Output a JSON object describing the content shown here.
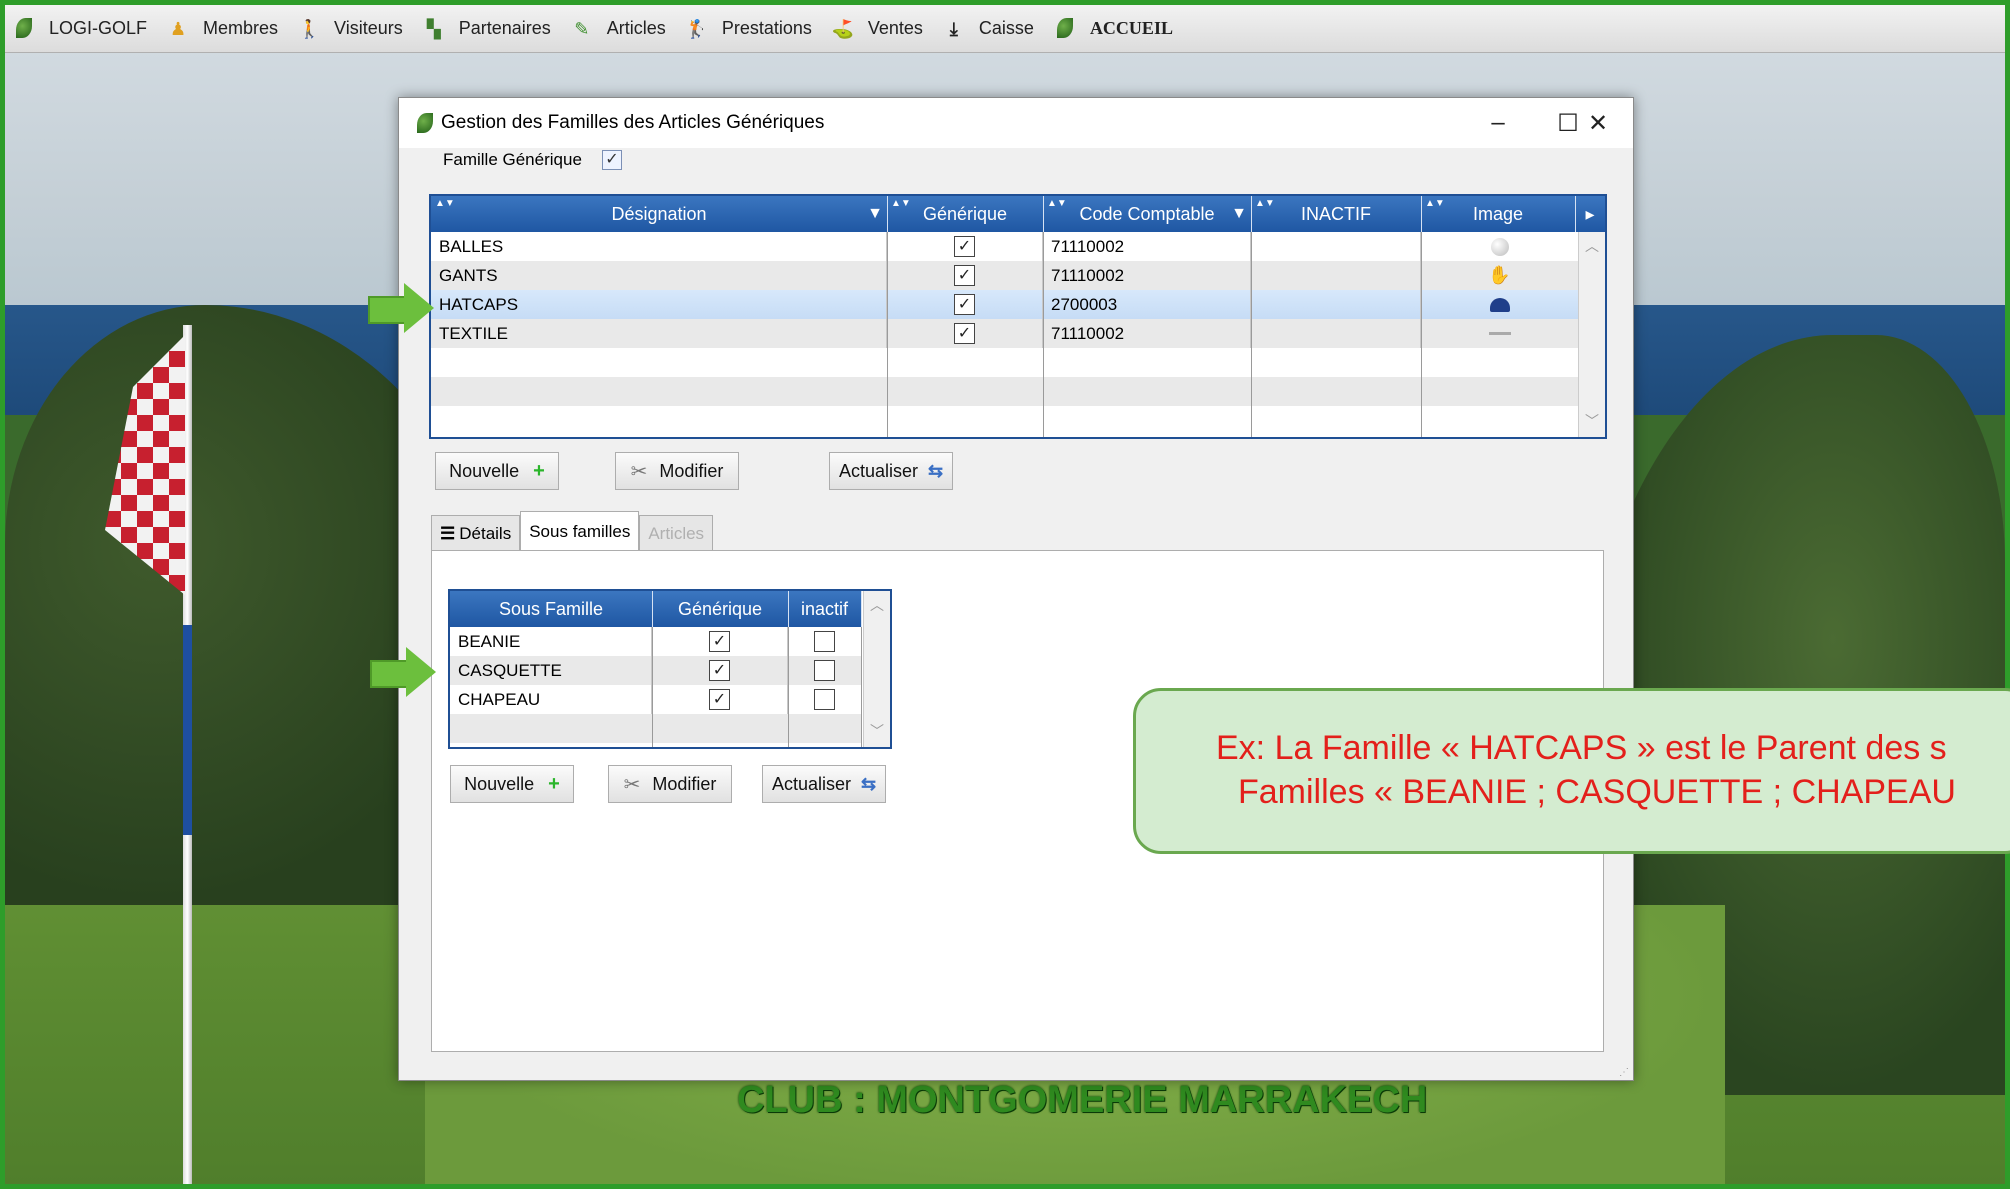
{
  "menubar": {
    "items": [
      {
        "label": "LOGI-GOLF",
        "icon": "logo-leaf-icon"
      },
      {
        "label": "Membres",
        "icon": "member-icon"
      },
      {
        "label": "Visiteurs",
        "icon": "walking-icon"
      },
      {
        "label": "Partenaires",
        "icon": "partner-icon"
      },
      {
        "label": "Articles",
        "icon": "pencil-icon"
      },
      {
        "label": "Prestations",
        "icon": "golfer-icon"
      },
      {
        "label": "Ventes",
        "icon": "golf-shoe-icon"
      },
      {
        "label": "Caisse",
        "icon": "download-icon"
      },
      {
        "label": "ACCUEIL",
        "icon": "home-leaf-icon"
      }
    ]
  },
  "dialog": {
    "title": "Gestion des Familles des Articles Génériques",
    "famille_generique_label": "Famille Générique",
    "famille_generique_checked": true,
    "families_grid": {
      "columns": [
        "Désignation",
        "Générique",
        "Code Comptable",
        "INACTIF",
        "Image"
      ],
      "rows": [
        {
          "designation": "BALLES",
          "generique": true,
          "code": "71110002",
          "inactif": "",
          "image": "golf-ball-icon"
        },
        {
          "designation": "GANTS",
          "generique": true,
          "code": "71110002",
          "inactif": "",
          "image": "glove-icon"
        },
        {
          "designation": "HATCAPS",
          "generique": true,
          "code": "2700003",
          "inactif": "",
          "image": "cap-icon",
          "selected": true
        },
        {
          "designation": "TEXTILE",
          "generique": true,
          "code": "71110002",
          "inactif": "",
          "image": "textile-icon"
        }
      ]
    },
    "buttons_top": {
      "nouvelle": "Nouvelle",
      "modifier": "Modifier",
      "actualiser": "Actualiser"
    },
    "tabs": [
      {
        "label": "Détails",
        "state": "normal"
      },
      {
        "label": "Sous familles",
        "state": "active"
      },
      {
        "label": "Articles",
        "state": "disabled"
      }
    ],
    "subfamilies_grid": {
      "columns": [
        "Sous Famille",
        "Générique",
        "inactif"
      ],
      "rows": [
        {
          "name": "BEANIE",
          "generique": true,
          "inactif": false
        },
        {
          "name": "CASQUETTE",
          "generique": true,
          "inactif": false
        },
        {
          "name": "CHAPEAU",
          "generique": true,
          "inactif": false
        }
      ]
    },
    "buttons_bottom": {
      "nouvelle": "Nouvelle",
      "modifier": "Modifier",
      "actualiser": "Actualiser"
    }
  },
  "callout": {
    "line1": "Ex: La Famille « HATCAPS » est le Parent des s",
    "line2": "Familles « BEANIE ; CASQUETTE ; CHAPEAU",
    "text_color": "#e3201b"
  },
  "footer": {
    "club": "CLUB : MONTGOMERIE MARRAKECH"
  },
  "colors": {
    "header_blue": "#1f57a3",
    "frame_green": "#2e9d2a",
    "selection": "#c6dcf5"
  }
}
